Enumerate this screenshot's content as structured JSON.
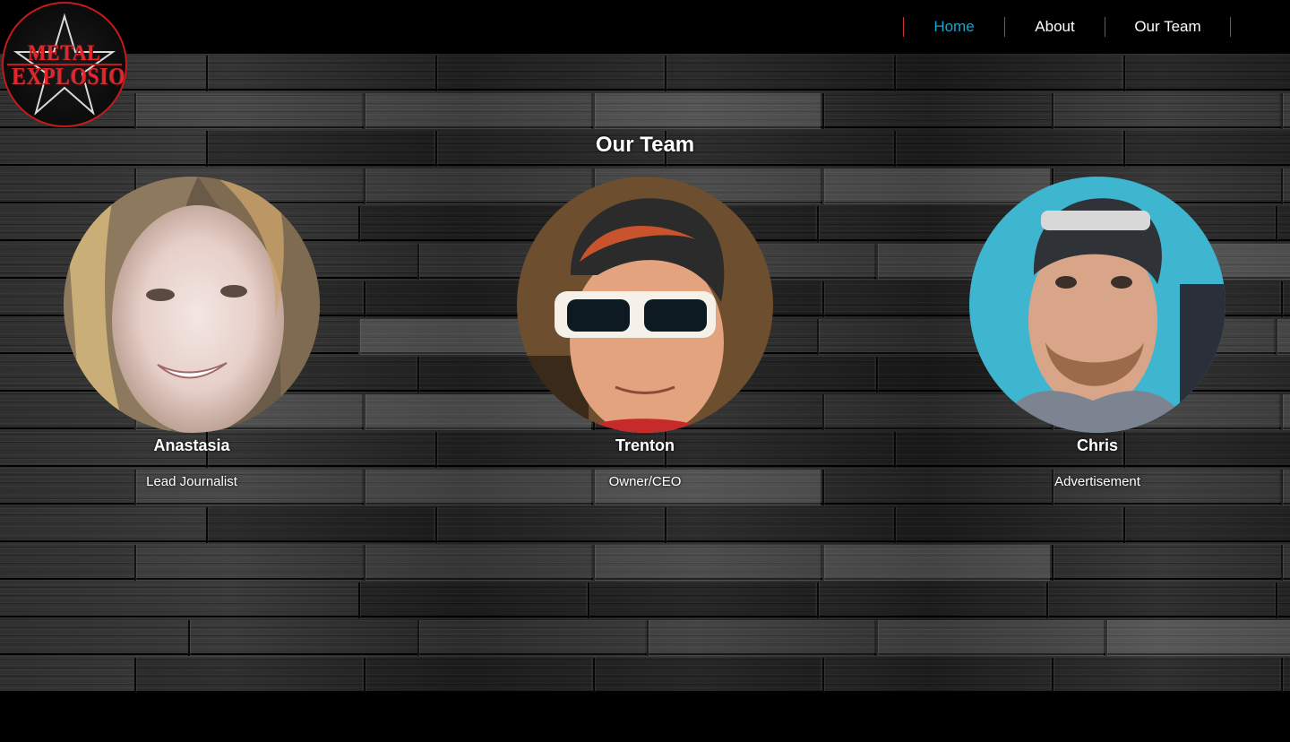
{
  "logo": {
    "line1": "METAL",
    "line2": "EXPLOSION",
    "brand_color": "#e3262c"
  },
  "nav": {
    "items": [
      {
        "label": "Home",
        "active": true
      },
      {
        "label": "About",
        "active": false
      },
      {
        "label": "Our Team",
        "active": false
      }
    ],
    "active_color": "#1aa3c9",
    "separator_color": "#c8322d"
  },
  "main": {
    "title": "Our Team",
    "members": [
      {
        "name": "Anastasia",
        "role": "Lead Journalist"
      },
      {
        "name": "Trenton",
        "role": "Owner/CEO"
      },
      {
        "name": "Chris",
        "role": "Advertisement"
      }
    ]
  }
}
